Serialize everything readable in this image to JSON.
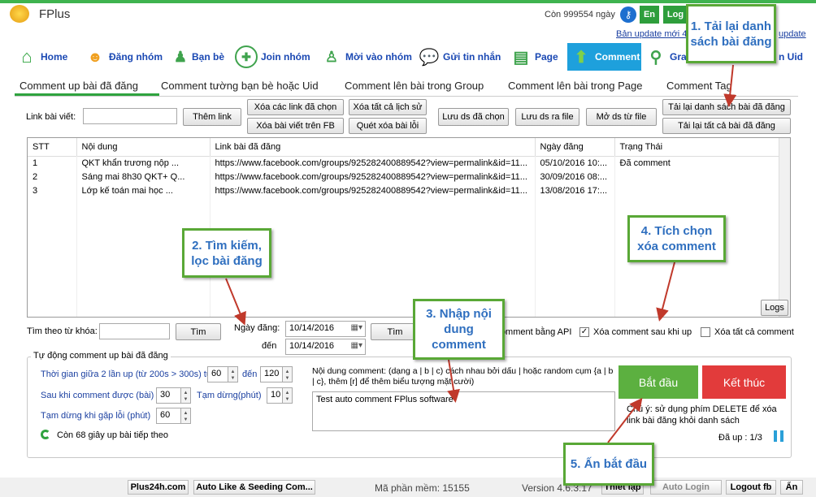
{
  "app": {
    "title": "FPlus",
    "remaining": "Còn 999554 ngày",
    "lang": "En",
    "login": "Log"
  },
  "update": {
    "link1": "Bản update mới 4.",
    "link2": "update"
  },
  "nav": [
    {
      "label": "Home",
      "icon": "house-icon"
    },
    {
      "label": "Đăng nhóm",
      "icon": "group-icon"
    },
    {
      "label": "Bạn bè",
      "icon": "person-icon"
    },
    {
      "label": "Join nhóm",
      "icon": "join-group-icon"
    },
    {
      "label": "Mời vào nhóm",
      "icon": "invite-icon"
    },
    {
      "label": "Gửi tin nhắn",
      "icon": "chat-icon"
    },
    {
      "label": "Page",
      "icon": "page-icon"
    },
    {
      "label": "Comment",
      "icon": "up-arrow-icon"
    },
    {
      "label": "Gra",
      "icon": "search-icon"
    },
    {
      "label": "n Uid",
      "icon": ""
    }
  ],
  "tabs": [
    "Comment up bài đã đăng",
    "Comment tường bạn bè hoặc Uid",
    "Comment lên bài trong Group",
    "Comment lên bài trong Page",
    "Comment Tag"
  ],
  "toolbar": {
    "link_label": "Link bài viết:",
    "add_link": "Thêm link",
    "del_selected_links": "Xóa các link đã chọn",
    "del_fb_posts": "Xóa bài viết trên FB",
    "del_all_history": "Xóa tất cả lịch sử",
    "scan_error_posts": "Quét xóa bài lỗi",
    "save_selected": "Lưu ds đã chọn",
    "save_file": "Lưu ds ra file",
    "open_file": "Mở ds từ file",
    "reload_list": "Tải lại danh sách bài đã đăng",
    "reload_all": "Tải lại tất cả bài đã đăng"
  },
  "table": {
    "headers": [
      "STT",
      "Nội dung",
      "Link bài đã đăng",
      "Ngày đăng",
      "Trạng Thái"
    ],
    "rows": [
      {
        "stt": "1",
        "content": "QKT khẩn trương nộp ...",
        "link": "https://www.facebook.com/groups/925282400889542?view=permalink&id=11...",
        "date": "05/10/2016 10:...",
        "status": "Đã comment"
      },
      {
        "stt": "2",
        "content": "Sáng mai 8h30 QKT+ Q...",
        "link": "https://www.facebook.com/groups/925282400889542?view=permalink&id=11...",
        "date": "30/09/2016 08:...",
        "status": ""
      },
      {
        "stt": "3",
        "content": "Lớp kế toán mai học ...",
        "link": "https://www.facebook.com/groups/925282400889542?view=permalink&id=11...",
        "date": "13/08/2016 17:...",
        "status": ""
      }
    ],
    "logs_button": "Logs"
  },
  "search": {
    "keyword_label": "Tìm theo từ khóa:",
    "find1": "Tìm",
    "date_label": "Ngày đăng:",
    "date_from": "10/14/2016",
    "to_label": "đến",
    "date_to": "10/14/2016",
    "find2": "Tìm",
    "api_label": "Comment bằng API",
    "del_after_label": "Xóa comment sau khi up",
    "del_all_label": "Xóa tất cả comment"
  },
  "auto": {
    "group_title": "Tự động comment  up bài đã đăng",
    "interval_label": "Thời gian giữa 2 lần up (từ 200s > 300s) từ",
    "interval_from": "60",
    "interval_to_label": "đến",
    "interval_to": "120",
    "after_label": "Sau khi comment được (bài)",
    "after_value": "30",
    "pause_label": "Tạm dừng(phút)",
    "pause_value": "10",
    "error_label": "Tạm dừng khi gặp lỗi (phút)",
    "error_value": "60",
    "countdown": "Còn 68 giây up bài tiếp theo",
    "content_label": "Nội dung comment: (dạng a | b | c) cách nhau bởi dấu | hoặc random cụm {a | b | c}, thêm [r] để thêm biểu tượng mặt cười)",
    "content_value": "Test auto comment FPlus software",
    "start": "Bắt đầu",
    "stop": "Kết thúc",
    "note": "Chú ý: sử dụng phím DELETE để xóa link bài đăng khỏi danh sách",
    "progress": "Đã up : 1/3"
  },
  "status": {
    "site": "Plus24h.com",
    "seeding": "Auto Like & Seeding Com...",
    "code": "Mã phần mềm: 15155",
    "version": "Version 4.6.3.17",
    "setup": "Thiết lập",
    "auto_login": "Auto Login",
    "logout": "Logout fb",
    "hide": "Ẩn"
  },
  "callouts": {
    "c1": "1. Tải lại danh sách bài đăng",
    "c2": "2. Tìm kiếm, lọc bài đăng",
    "c3": "3. Nhập nội dung comment",
    "c4": "4. Tích chọn xóa comment",
    "c5": "5. Ấn bắt đầu"
  },
  "colors": {
    "accent": "#1a48b3",
    "active_tab": "#1ea0dc",
    "start": "#5cb040",
    "stop": "#e23b3b",
    "callout_border": "#59a836"
  }
}
